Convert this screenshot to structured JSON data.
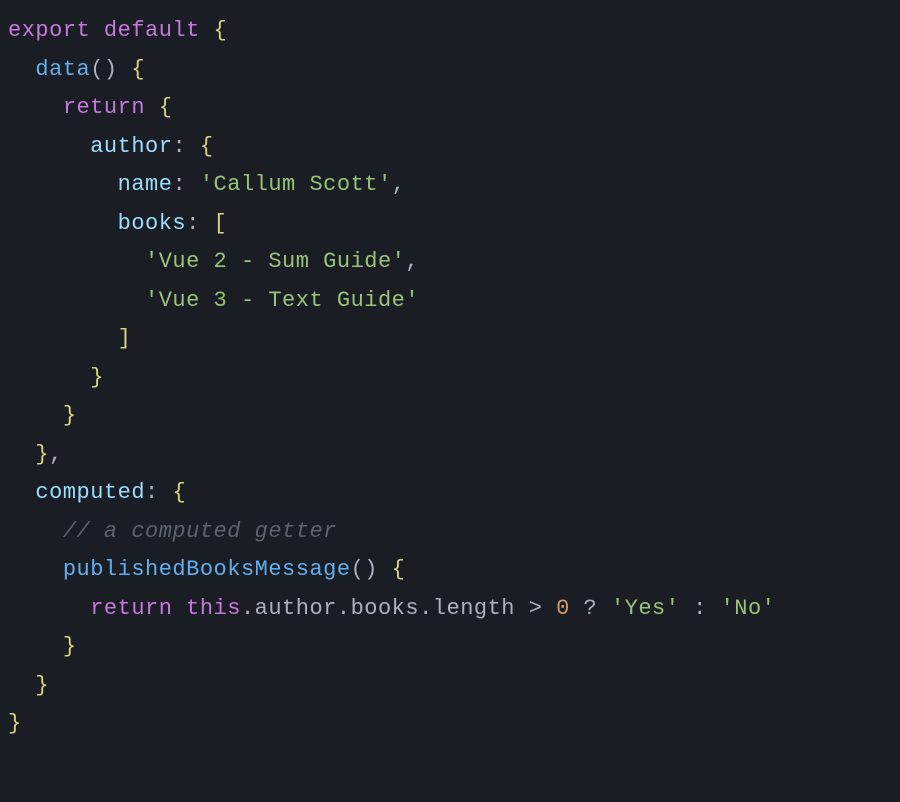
{
  "code": {
    "l1_export": "export",
    "l1_default": "default",
    "l1_brace": " {",
    "l2_indent": "  ",
    "l2_data": "data",
    "l2_parens": "()",
    "l2_brace": " {",
    "l3_indent": "    ",
    "l3_return": "return",
    "l3_brace": " {",
    "l4_indent": "      ",
    "l4_key": "author",
    "l4_colon": ": ",
    "l4_brace": "{",
    "l5_indent": "        ",
    "l5_key": "name",
    "l5_colon": ": ",
    "l5_val": "'Callum Scott'",
    "l5_comma": ",",
    "l6_indent": "        ",
    "l6_key": "books",
    "l6_colon": ": ",
    "l6_bracket": "[",
    "l7_indent": "          ",
    "l7_val": "'Vue 2 - Sum Guide'",
    "l7_comma": ",",
    "l8_indent": "          ",
    "l8_val": "'Vue 3 - Text Guide'",
    "l9_indent": "        ",
    "l9_bracket": "]",
    "l10_indent": "      ",
    "l10_brace": "}",
    "l11_indent": "    ",
    "l11_brace": "}",
    "l12_indent": "  ",
    "l12_brace": "}",
    "l12_comma": ",",
    "l13_indent": "  ",
    "l13_key": "computed",
    "l13_colon": ": ",
    "l13_brace": "{",
    "l14_indent": "    ",
    "l14_comment": "// a computed getter",
    "l15_indent": "    ",
    "l15_fn": "publishedBooksMessage",
    "l15_parens": "()",
    "l15_brace": " {",
    "l16_indent": "      ",
    "l16_return": "return",
    "l16_sp": " ",
    "l16_this": "this",
    "l16_dot1": ".",
    "l16_author": "author",
    "l16_dot2": ".",
    "l16_books": "books",
    "l16_dot3": ".",
    "l16_length": "length",
    "l16_gt": " > ",
    "l16_zero": "0",
    "l16_q": " ? ",
    "l16_yes": "'Yes'",
    "l16_colon": " : ",
    "l16_no": "'No'",
    "l17_indent": "    ",
    "l17_brace": "}",
    "l18_indent": "  ",
    "l18_brace": "}",
    "l19_brace": "}"
  }
}
